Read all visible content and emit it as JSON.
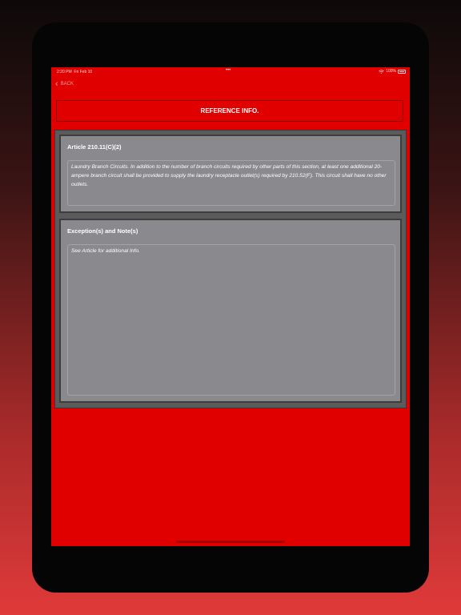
{
  "status_bar": {
    "time": "2:20 PM",
    "date": "Fri Feb 10",
    "dots": "•••",
    "battery": "100%"
  },
  "nav": {
    "back_label": "BACK"
  },
  "header": {
    "title": "REFERENCE INFO."
  },
  "article": {
    "title": "Article 210.11(C)(2)",
    "text": "Laundry Branch Circuits. In addition to the number of branch circuits required by other parts of this section, at least one additional 20-ampere branch circuit shall be provided to supply the laundry receptacle outlet(s) required by 210.52(F). This circuit shall have no other outlets."
  },
  "notes": {
    "title": "Exception(s) and Note(s)",
    "text": "See Article for additional Info."
  },
  "colors": {
    "accent": "#e00000",
    "panel": "#8a8a8e",
    "frame": "#5b5b5b"
  }
}
